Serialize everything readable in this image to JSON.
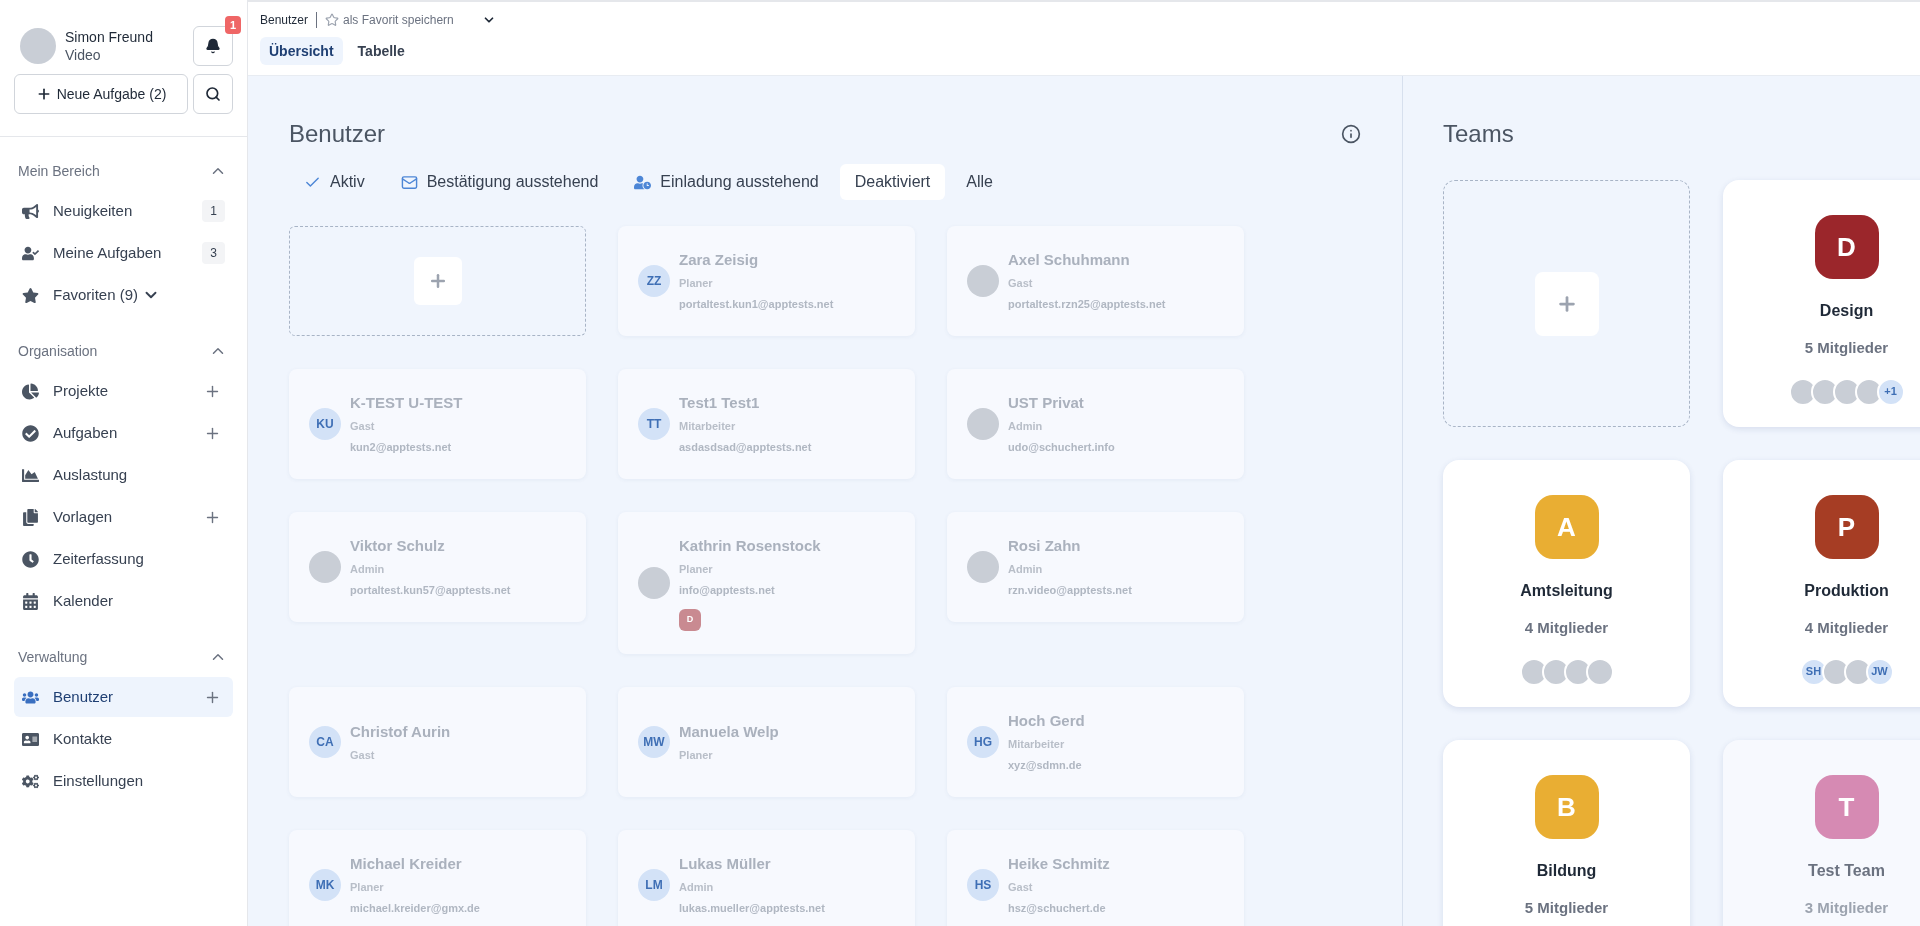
{
  "sidebar": {
    "user": {
      "name": "Simon Freund",
      "subtitle": "Video"
    },
    "notifications": {
      "count": "1"
    },
    "new_task_button": "Neue Aufgabe (2)",
    "sections": [
      {
        "title": "Mein Bereich",
        "expanded": true,
        "items": [
          {
            "label": "Neuigkeiten",
            "count": "1",
            "kind": "link",
            "add": false,
            "selected": false
          },
          {
            "label": "Meine Aufgaben",
            "count": "3",
            "kind": "link",
            "add": false,
            "selected": false
          },
          {
            "label": "Favoriten (9)",
            "kind": "dropdown",
            "add": false,
            "selected": false
          }
        ]
      },
      {
        "title": "Organisation",
        "expanded": true,
        "items": [
          {
            "label": "Projekte",
            "kind": "link",
            "add": true,
            "selected": false
          },
          {
            "label": "Aufgaben",
            "kind": "link",
            "add": true,
            "selected": false
          },
          {
            "label": "Auslastung",
            "kind": "link",
            "add": false,
            "selected": false
          },
          {
            "label": "Vorlagen",
            "kind": "link",
            "add": true,
            "selected": false
          },
          {
            "label": "Zeiterfassung",
            "kind": "link",
            "add": false,
            "selected": false
          },
          {
            "label": "Kalender",
            "kind": "link",
            "add": false,
            "selected": false
          }
        ]
      },
      {
        "title": "Verwaltung",
        "expanded": true,
        "items": [
          {
            "label": "Benutzer",
            "kind": "link",
            "add": true,
            "selected": true
          },
          {
            "label": "Kontakte",
            "kind": "link",
            "add": false,
            "selected": false
          },
          {
            "label": "Einstellungen",
            "kind": "link",
            "add": false,
            "selected": false
          }
        ]
      }
    ]
  },
  "header": {
    "breadcrumb": "Benutzer",
    "favorite_link": "als Favorit speichern",
    "tabs": [
      {
        "label": "Übersicht",
        "selected": true
      },
      {
        "label": "Tabelle",
        "selected": false
      }
    ]
  },
  "users_panel": {
    "title": "Benutzer",
    "filters": [
      {
        "label": "Aktiv",
        "selected": false
      },
      {
        "label": "Bestätigung ausstehend",
        "selected": false
      },
      {
        "label": "Einladung ausstehend",
        "selected": false
      },
      {
        "label": "Deaktiviert",
        "selected": true
      },
      {
        "label": "Alle",
        "selected": false
      }
    ],
    "users": [
      {
        "name": "Zara Zeisig",
        "role": "Planer",
        "email": "portaltest.kun1@apptests.net",
        "avatar": {
          "kind": "initials",
          "text": "ZZ"
        }
      },
      {
        "name": "Axel Schuhmann",
        "role": "Gast",
        "email": "portaltest.rzn25@apptests.net",
        "avatar": {
          "kind": "photo"
        }
      },
      {
        "name": "K-TEST U-TEST",
        "role": "Gast",
        "email": "kun2@apptests.net",
        "avatar": {
          "kind": "initials",
          "text": "KU"
        }
      },
      {
        "name": "Test1 Test1",
        "role": "Mitarbeiter",
        "email": "asdasdsad@apptests.net",
        "avatar": {
          "kind": "initials",
          "text": "TT"
        }
      },
      {
        "name": "UST Privat",
        "role": "Admin",
        "email": "udo@schuchert.info",
        "avatar": {
          "kind": "photo"
        }
      },
      {
        "name": "Viktor Schulz",
        "role": "Admin",
        "email": "portaltest.kun57@apptests.net",
        "avatar": {
          "kind": "photo"
        }
      },
      {
        "name": "Kathrin Rosenstock",
        "role": "Planer",
        "email": "info@apptests.net",
        "avatar": {
          "kind": "photo"
        },
        "teams": [
          {
            "letter": "D",
            "color": "#c98a91"
          }
        ]
      },
      {
        "name": "Rosi Zahn",
        "role": "Admin",
        "email": "rzn.video@apptests.net",
        "avatar": {
          "kind": "photo"
        }
      },
      {
        "name": "Christof Aurin",
        "role": "Gast",
        "avatar": {
          "kind": "initials",
          "text": "CA"
        }
      },
      {
        "name": "Manuela Welp",
        "role": "Planer",
        "avatar": {
          "kind": "initials",
          "text": "MW"
        }
      },
      {
        "name": "Hoch Gerd",
        "role": "Mitarbeiter",
        "email": "xyz@sdmn.de",
        "avatar": {
          "kind": "initials",
          "text": "HG"
        }
      },
      {
        "name": "Michael Kreider",
        "role": "Planer",
        "email": "michael.kreider@gmx.de",
        "avatar": {
          "kind": "initials",
          "text": "MK"
        }
      },
      {
        "name": "Lukas Müller",
        "role": "Admin",
        "email": "lukas.mueller@apptests.net",
        "avatar": {
          "kind": "initials",
          "text": "LM"
        }
      },
      {
        "name": "Heike Schmitz",
        "role": "Gast",
        "email": "hsz@schuchert.de",
        "avatar": {
          "kind": "initials",
          "text": "HS"
        }
      }
    ]
  },
  "teams_panel": {
    "title": "Teams",
    "teams": [
      {
        "letter": "D",
        "name": "Design",
        "members": "5 Mitglieder",
        "color": "#9b262b",
        "inactive": false,
        "avatars": [
          {
            "kind": "photo"
          },
          {
            "kind": "photo"
          },
          {
            "kind": "photo"
          },
          {
            "kind": "photo"
          },
          {
            "kind": "initials",
            "text": "+1"
          }
        ]
      },
      {
        "letter": "A",
        "name": "Amtsleitung",
        "members": "4 Mitglieder",
        "color": "#e9ae33",
        "inactive": false,
        "avatars": [
          {
            "kind": "photo"
          },
          {
            "kind": "photo"
          },
          {
            "kind": "photo"
          },
          {
            "kind": "photo"
          }
        ]
      },
      {
        "letter": "P",
        "name": "Produktion",
        "members": "4 Mitglieder",
        "color": "#a63d24",
        "inactive": false,
        "avatars": [
          {
            "kind": "initials",
            "text": "SH"
          },
          {
            "kind": "photo"
          },
          {
            "kind": "photo"
          },
          {
            "kind": "initials",
            "text": "JW"
          }
        ]
      },
      {
        "letter": "B",
        "name": "Bildung",
        "members": "5 Mitglieder",
        "color": "#e9ae33",
        "inactive": false
      },
      {
        "letter": "T",
        "name": "Test Team",
        "members": "3 Mitglieder",
        "color": "#d68ab3",
        "inactive": true
      }
    ]
  }
}
